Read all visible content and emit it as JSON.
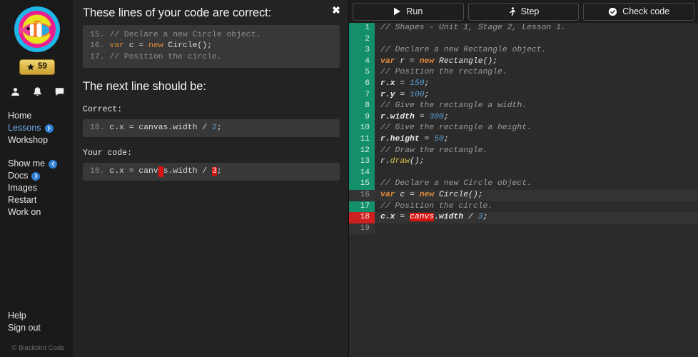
{
  "sidebar": {
    "avatar_name": "clownfish-avatar",
    "star_count": "59",
    "icons": [
      {
        "name": "profile-icon"
      },
      {
        "name": "notifications-bell-icon"
      },
      {
        "name": "messages-chat-icon"
      }
    ],
    "nav_primary": [
      {
        "label": "Home",
        "name": "sidebar-item-home",
        "active": false,
        "chevron": "none"
      },
      {
        "label": "Lessons",
        "name": "sidebar-item-lessons",
        "active": true,
        "chevron": "right"
      },
      {
        "label": "Workshop",
        "name": "sidebar-item-workshop",
        "active": false,
        "chevron": "none"
      }
    ],
    "nav_secondary": [
      {
        "label": "Show me",
        "name": "sidebar-item-show-me",
        "active": false,
        "chevron": "left"
      },
      {
        "label": "Docs",
        "name": "sidebar-item-docs",
        "active": false,
        "chevron": "right"
      },
      {
        "label": "Images",
        "name": "sidebar-item-images",
        "active": false,
        "chevron": "none"
      },
      {
        "label": "Restart",
        "name": "sidebar-item-restart",
        "active": false,
        "chevron": "none"
      },
      {
        "label": "Work on",
        "name": "sidebar-item-work-on",
        "active": false,
        "chevron": "none"
      }
    ],
    "nav_bottom": [
      {
        "label": "Help",
        "name": "sidebar-item-help"
      },
      {
        "label": "Sign out",
        "name": "sidebar-item-sign-out"
      }
    ],
    "footer": "© Blackbird Code"
  },
  "feedback": {
    "close_label": "✖",
    "heading_correct": "These lines of your code are correct:",
    "heading_next": "The next line should be:",
    "label_correct": "Correct:",
    "label_your_code": "Your code:",
    "correct_lines": [
      {
        "num": "15.",
        "kind": "comment",
        "text": "// Declare a new Circle object."
      },
      {
        "num": "16.",
        "kind": "code",
        "text": "var c = new Circle();"
      },
      {
        "num": "17.",
        "kind": "comment",
        "text": "// Position the circle."
      }
    ],
    "expected_line": {
      "num": "18.",
      "text": "c.x = canvas.width / 2;",
      "highlight_number": "2"
    },
    "your_line": {
      "num": "18.",
      "prefix": "c.x = canv",
      "missing_char": "a",
      "middle": "s.width / ",
      "bad_token": "3",
      "suffix": ";"
    }
  },
  "toolbar": {
    "buttons": [
      {
        "label": "Run",
        "name": "run-button",
        "icon": "play-icon"
      },
      {
        "label": "Step",
        "name": "step-button",
        "icon": "walking-person-icon"
      },
      {
        "label": "Check code",
        "name": "check-code-button",
        "icon": "check-circle-icon"
      }
    ]
  },
  "editor": {
    "lines": [
      {
        "n": "1",
        "gutter": "ok",
        "current": false,
        "tokens": [
          {
            "t": "// Shapes - Unit 1, Stage 2, Lesson 1.",
            "c": "ecm"
          }
        ]
      },
      {
        "n": "2",
        "gutter": "ok",
        "current": false,
        "tokens": []
      },
      {
        "n": "3",
        "gutter": "ok",
        "current": false,
        "tokens": [
          {
            "t": "// Declare a new Rectangle object.",
            "c": "ecm"
          }
        ]
      },
      {
        "n": "4",
        "gutter": "ok",
        "current": false,
        "tokens": [
          {
            "t": "var",
            "c": "ekw"
          },
          {
            "t": " r = ",
            "c": "eid"
          },
          {
            "t": "new",
            "c": "ekw"
          },
          {
            "t": " Rectangle();",
            "c": "eid"
          }
        ]
      },
      {
        "n": "5",
        "gutter": "ok",
        "current": false,
        "tokens": [
          {
            "t": "// Position the rectangle.",
            "c": "ecm"
          }
        ]
      },
      {
        "n": "6",
        "gutter": "ok",
        "current": false,
        "tokens": [
          {
            "t": "r.x",
            "c": "eprop"
          },
          {
            "t": " = ",
            "c": "eid"
          },
          {
            "t": "150",
            "c": "enum"
          },
          {
            "t": ";",
            "c": "eid"
          }
        ]
      },
      {
        "n": "7",
        "gutter": "ok",
        "current": false,
        "tokens": [
          {
            "t": "r.y",
            "c": "eprop"
          },
          {
            "t": " = ",
            "c": "eid"
          },
          {
            "t": "100",
            "c": "enum"
          },
          {
            "t": ";",
            "c": "eid"
          }
        ]
      },
      {
        "n": "8",
        "gutter": "ok",
        "current": false,
        "tokens": [
          {
            "t": "// Give the rectangle a width.",
            "c": "ecm"
          }
        ]
      },
      {
        "n": "9",
        "gutter": "ok",
        "current": false,
        "tokens": [
          {
            "t": "r.width",
            "c": "eprop"
          },
          {
            "t": " = ",
            "c": "eid"
          },
          {
            "t": "300",
            "c": "enum"
          },
          {
            "t": ";",
            "c": "eid"
          }
        ]
      },
      {
        "n": "10",
        "gutter": "ok",
        "current": false,
        "tokens": [
          {
            "t": "// Give the rectangle a height.",
            "c": "ecm"
          }
        ]
      },
      {
        "n": "11",
        "gutter": "ok",
        "current": false,
        "tokens": [
          {
            "t": "r.height",
            "c": "eprop"
          },
          {
            "t": " = ",
            "c": "eid"
          },
          {
            "t": "50",
            "c": "enum"
          },
          {
            "t": ";",
            "c": "eid"
          }
        ]
      },
      {
        "n": "12",
        "gutter": "ok",
        "current": false,
        "tokens": [
          {
            "t": "// Draw the rectangle.",
            "c": "ecm"
          }
        ]
      },
      {
        "n": "13",
        "gutter": "ok",
        "current": false,
        "tokens": [
          {
            "t": "r.",
            "c": "eid"
          },
          {
            "t": "draw",
            "c": "efn"
          },
          {
            "t": "();",
            "c": "eid"
          }
        ]
      },
      {
        "n": "14",
        "gutter": "ok",
        "current": false,
        "tokens": []
      },
      {
        "n": "15",
        "gutter": "ok",
        "current": false,
        "tokens": [
          {
            "t": "// Declare a new Circle object.",
            "c": "ecm"
          }
        ]
      },
      {
        "n": "16",
        "gutter": "none",
        "current": true,
        "tokens": [
          {
            "t": "var",
            "c": "ekw"
          },
          {
            "t": " c = ",
            "c": "eid"
          },
          {
            "t": "new",
            "c": "ekw"
          },
          {
            "t": " Circle();",
            "c": "eid"
          }
        ]
      },
      {
        "n": "17",
        "gutter": "ok",
        "current": false,
        "tokens": [
          {
            "t": "// Position the circle.",
            "c": "ecm"
          }
        ]
      },
      {
        "n": "18",
        "gutter": "err",
        "current": true,
        "tokens": [
          {
            "t": "c.x",
            "c": "eprop"
          },
          {
            "t": " = ",
            "c": "eid"
          },
          {
            "t": "canvs",
            "c": "eerr"
          },
          {
            "t": ".width",
            "c": "eprop"
          },
          {
            "t": " / ",
            "c": "eid"
          },
          {
            "t": "3",
            "c": "enum"
          },
          {
            "t": ";",
            "c": "eid"
          }
        ]
      },
      {
        "n": "19",
        "gutter": "none",
        "current": false,
        "tokens": []
      }
    ]
  },
  "colors": {
    "accent_blue": "#6fa8e8",
    "gutter_ok": "#148f6b",
    "gutter_error": "#cf2020",
    "error_highlight": "#d81111",
    "keyword_orange": "#e08a3c",
    "number_blue": "#5a9fd4",
    "badge_gold": "#e0bb4c"
  }
}
